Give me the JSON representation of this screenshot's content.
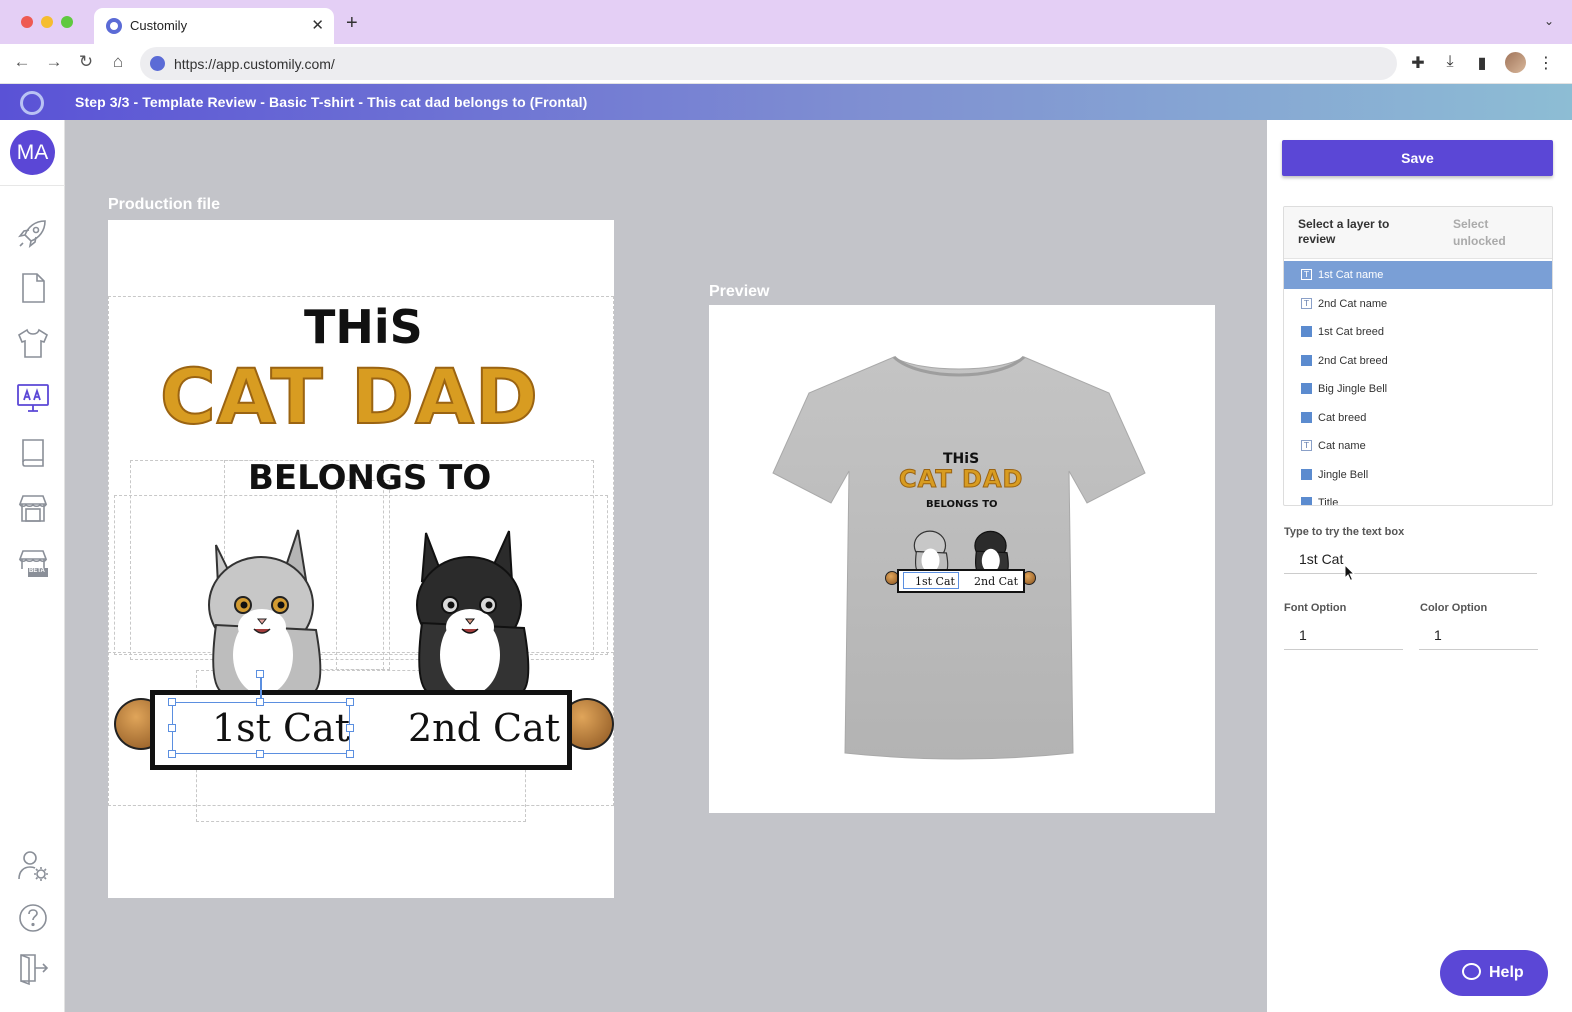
{
  "browser": {
    "tab_title": "Customily",
    "tab_close": "✕",
    "new_tab": "+",
    "tab_menu": "⌄",
    "url": "https://app.customily.com/",
    "nav": {
      "back": "←",
      "forward": "→",
      "reload": "↻",
      "home": "⌂"
    },
    "tools": {
      "extensions": "✚",
      "download": "⤓",
      "sidebar": "▮",
      "menu": "⋮"
    }
  },
  "app_header": {
    "title": "Step 3/3 - Template Review - Basic T-shirt - This cat dad belongs to (Frontal)"
  },
  "left_nav": {
    "avatar_initials": "MA",
    "icons": [
      "rocket-icon",
      "document-icon",
      "tshirt-icon",
      "monitor-icon",
      "book-icon",
      "store-icon",
      "store-beta-icon",
      "user-settings-icon",
      "help-circle-icon",
      "logout-icon"
    ],
    "beta_badge": "BETA"
  },
  "canvas": {
    "production_label": "Production file",
    "preview_label": "Preview",
    "artwork": {
      "line1": "THiS",
      "line2": "CAT DAD",
      "line3": "BELONGS TO",
      "cat1_name": "1st Cat",
      "cat2_name": "2nd Cat"
    }
  },
  "right_panel": {
    "save_label": "Save",
    "layer_header": "Select a layer to review",
    "select_unlocked": "Select unlocked",
    "layers": [
      {
        "label": "1st Cat name",
        "type": "text",
        "selected": true
      },
      {
        "label": "2nd Cat name",
        "type": "text",
        "selected": false
      },
      {
        "label": "1st Cat breed",
        "type": "image",
        "selected": false
      },
      {
        "label": "2nd Cat breed",
        "type": "image",
        "selected": false
      },
      {
        "label": "Big Jingle Bell",
        "type": "image",
        "selected": false
      },
      {
        "label": "Cat breed",
        "type": "image",
        "selected": false
      },
      {
        "label": "Cat name",
        "type": "text",
        "selected": false
      },
      {
        "label": "Jingle Bell",
        "type": "image",
        "selected": false
      },
      {
        "label": "Title",
        "type": "image",
        "selected": false
      }
    ],
    "text_box_label": "Type to try the text box",
    "text_box_value": "1st Cat",
    "font_option_label": "Font Option",
    "font_option_value": "1",
    "color_option_label": "Color Option",
    "color_option_value": "1"
  },
  "help": {
    "label": "Help"
  },
  "colors": {
    "accent": "#5b47d6",
    "header_gradient_start": "#5a52d6",
    "header_gradient_end": "#8dbdd4",
    "canvas_bg": "#c3c4c9",
    "selected_layer": "#7a9fd6",
    "cat_dad_orange": "#d89c21"
  }
}
